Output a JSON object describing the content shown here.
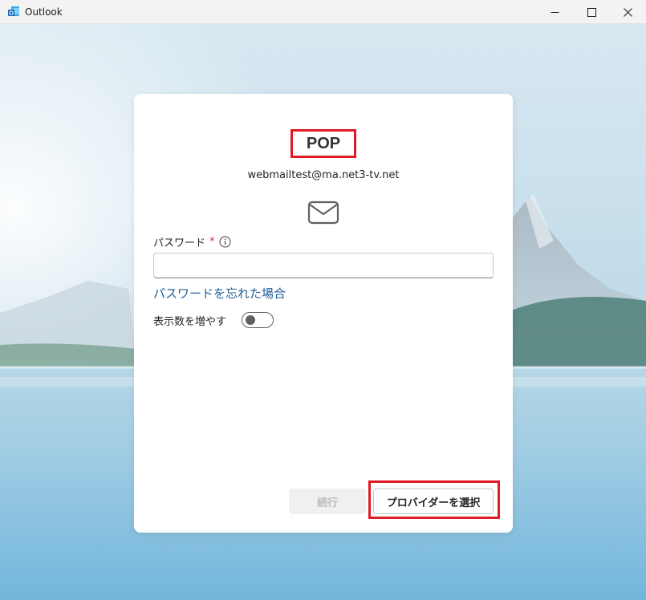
{
  "window": {
    "title": "Outlook"
  },
  "card": {
    "title": "POP",
    "email": "webmailtest@ma.net3-tv.net",
    "password_label": "パスワード",
    "required_mark": "*",
    "password_value": "",
    "password_placeholder": "",
    "forgot_link": "パスワードを忘れた場合",
    "toggle_label": "表示数を増やす",
    "toggle_on": false,
    "continue_label": "続行",
    "provider_label": "プロバイダーを選択"
  },
  "colors": {
    "accent_link": "#1f5d93",
    "highlight_frame": "#e01b24",
    "required": "#c4314b"
  },
  "icons": {
    "app": "outlook-logo-icon",
    "minimize": "minimize-icon",
    "maximize": "maximize-icon",
    "close": "close-icon",
    "mail": "envelope-icon",
    "info": "info-icon"
  }
}
